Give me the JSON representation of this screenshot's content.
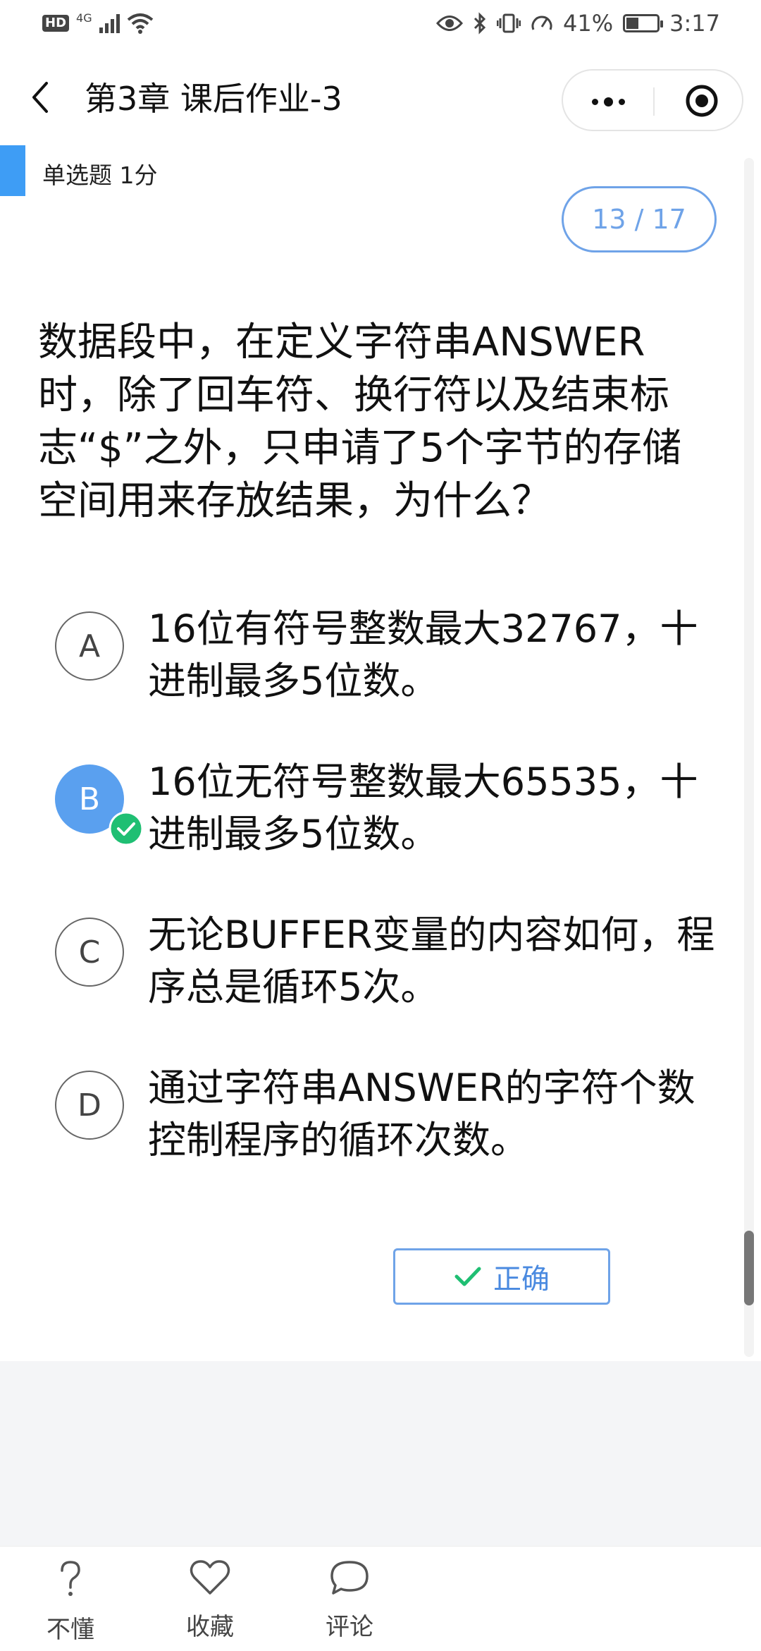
{
  "status_bar": {
    "hd": "HD",
    "network": "4G",
    "battery_percent": "41%",
    "battery_level": 0.41,
    "time": "3:17"
  },
  "header": {
    "title": "第3章 课后作业-3"
  },
  "question": {
    "type_label": "单选题 1分",
    "pager": "13 / 17",
    "text": "数据段中，在定义字符串ANSWER时，除了回车符、换行符以及结束标志“$”之外，只申请了5个字节的存储空间用来存放结果，为什么？",
    "options": [
      {
        "letter": "A",
        "text": "16位有符号整数最大32767，十进制最多5位数。",
        "selected": false
      },
      {
        "letter": "B",
        "text": "16位无符号整数最大65535，十进制最多5位数。",
        "selected": true
      },
      {
        "letter": "C",
        "text": "无论BUFFER变量的内容如何，程序总是循环5次。",
        "selected": false
      },
      {
        "letter": "D",
        "text": "通过字符串ANSWER的字符个数控制程序的循环次数。",
        "selected": false
      }
    ],
    "result_label": "正确"
  },
  "bottom_bar": {
    "dont_understand": "不懂",
    "favorite": "收藏",
    "comment": "评论"
  },
  "colors": {
    "accent": "#3e9df5",
    "selected": "#5aa0ef",
    "correct_green": "#1fbf73",
    "pager_blue": "#6fa3e8"
  }
}
